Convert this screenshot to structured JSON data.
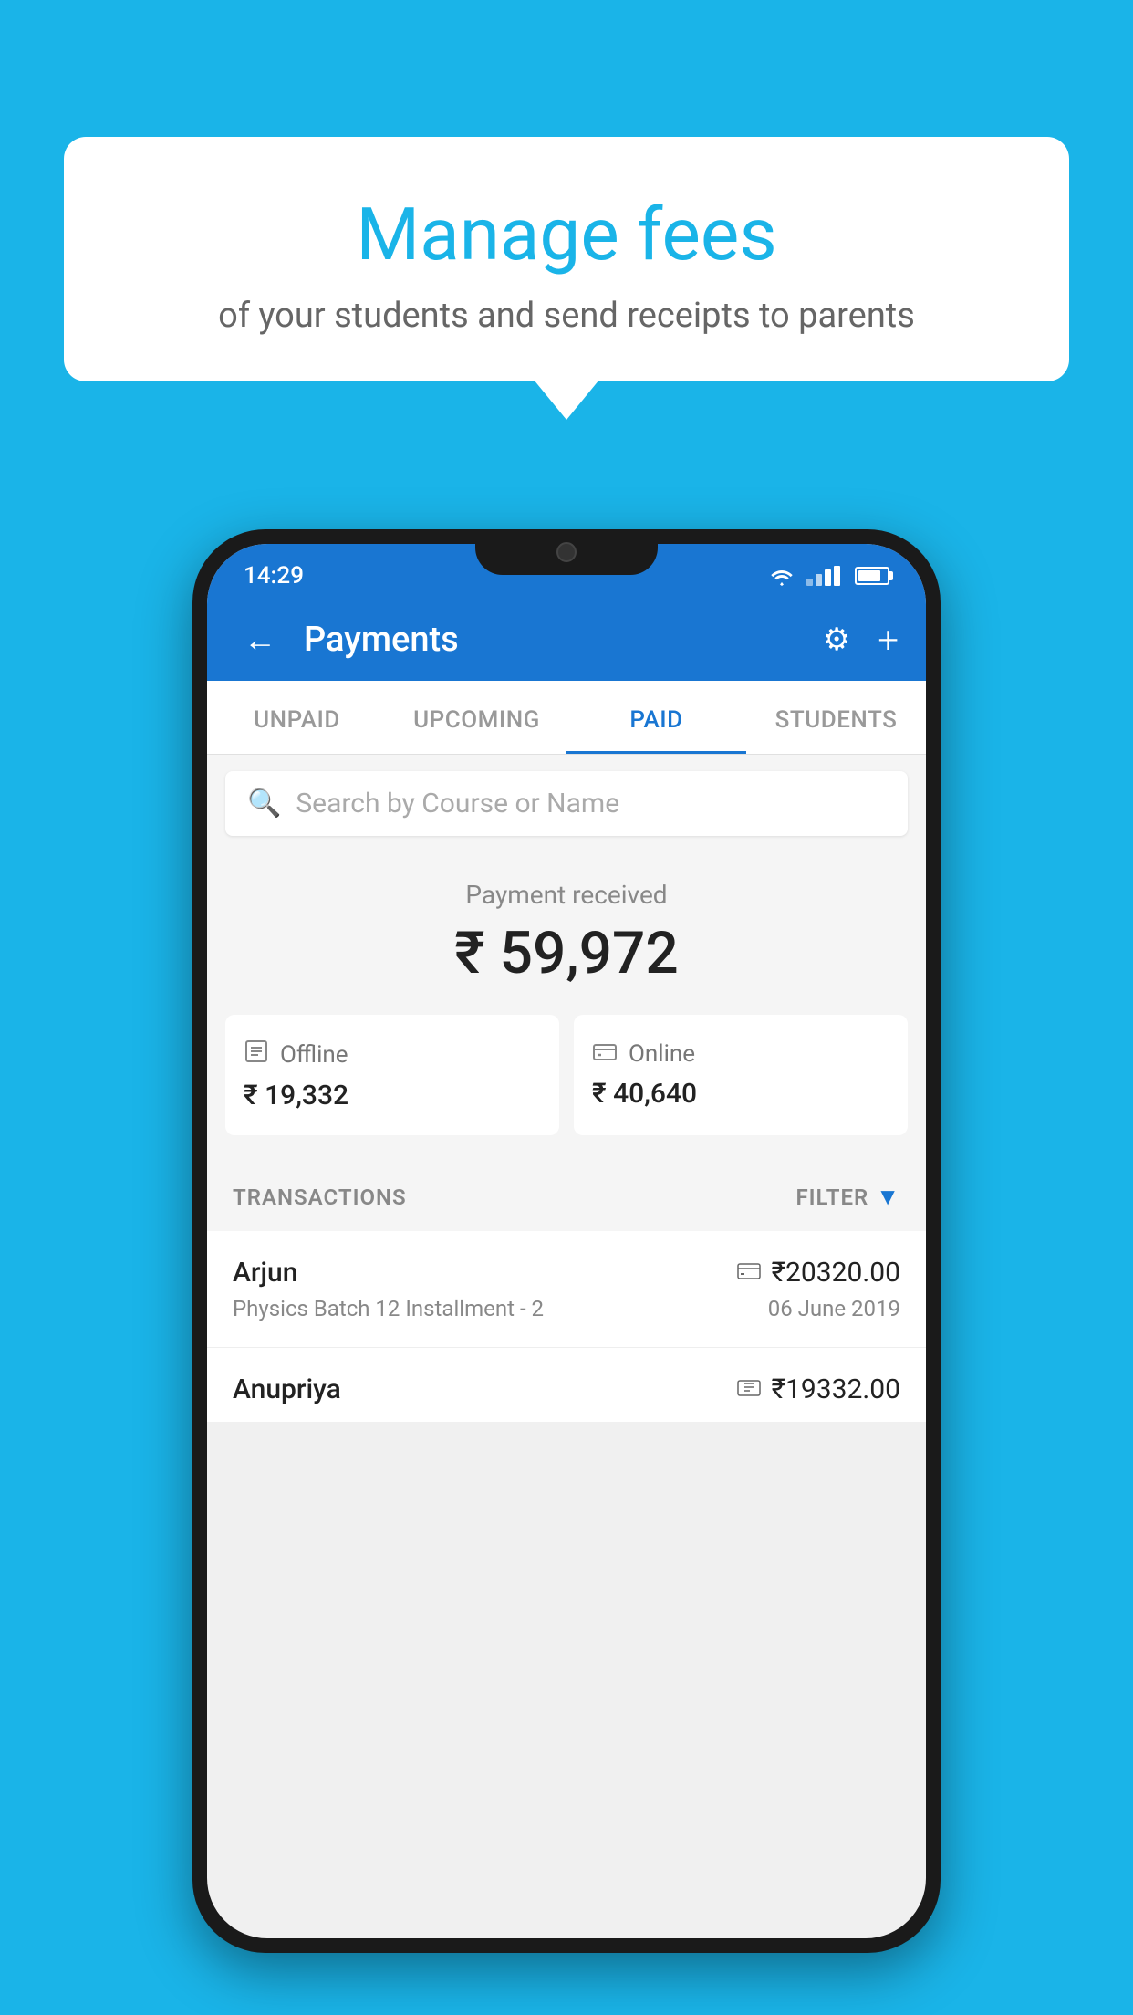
{
  "background_color": "#1ab4e8",
  "bubble": {
    "title": "Manage fees",
    "subtitle": "of your students and send receipts to parents"
  },
  "status_bar": {
    "time": "14:29"
  },
  "app_bar": {
    "title": "Payments",
    "back_label": "←",
    "gear_label": "⚙",
    "plus_label": "+"
  },
  "tabs": [
    {
      "label": "UNPAID",
      "active": false
    },
    {
      "label": "UPCOMING",
      "active": false
    },
    {
      "label": "PAID",
      "active": true
    },
    {
      "label": "STUDENTS",
      "active": false
    }
  ],
  "search": {
    "placeholder": "Search by Course or Name"
  },
  "payment_summary": {
    "label": "Payment received",
    "total": "₹ 59,972",
    "offline": {
      "label": "Offline",
      "amount": "₹ 19,332"
    },
    "online": {
      "label": "Online",
      "amount": "₹ 40,640"
    }
  },
  "transactions": {
    "header_label": "TRANSACTIONS",
    "filter_label": "FILTER",
    "rows": [
      {
        "name": "Arjun",
        "amount": "₹20320.00",
        "mode_icon": "💳",
        "course": "Physics Batch 12 Installment - 2",
        "date": "06 June 2019"
      },
      {
        "name": "Anupriya",
        "amount": "₹19332.00",
        "mode_icon": "🧾",
        "course": "",
        "date": ""
      }
    ]
  }
}
